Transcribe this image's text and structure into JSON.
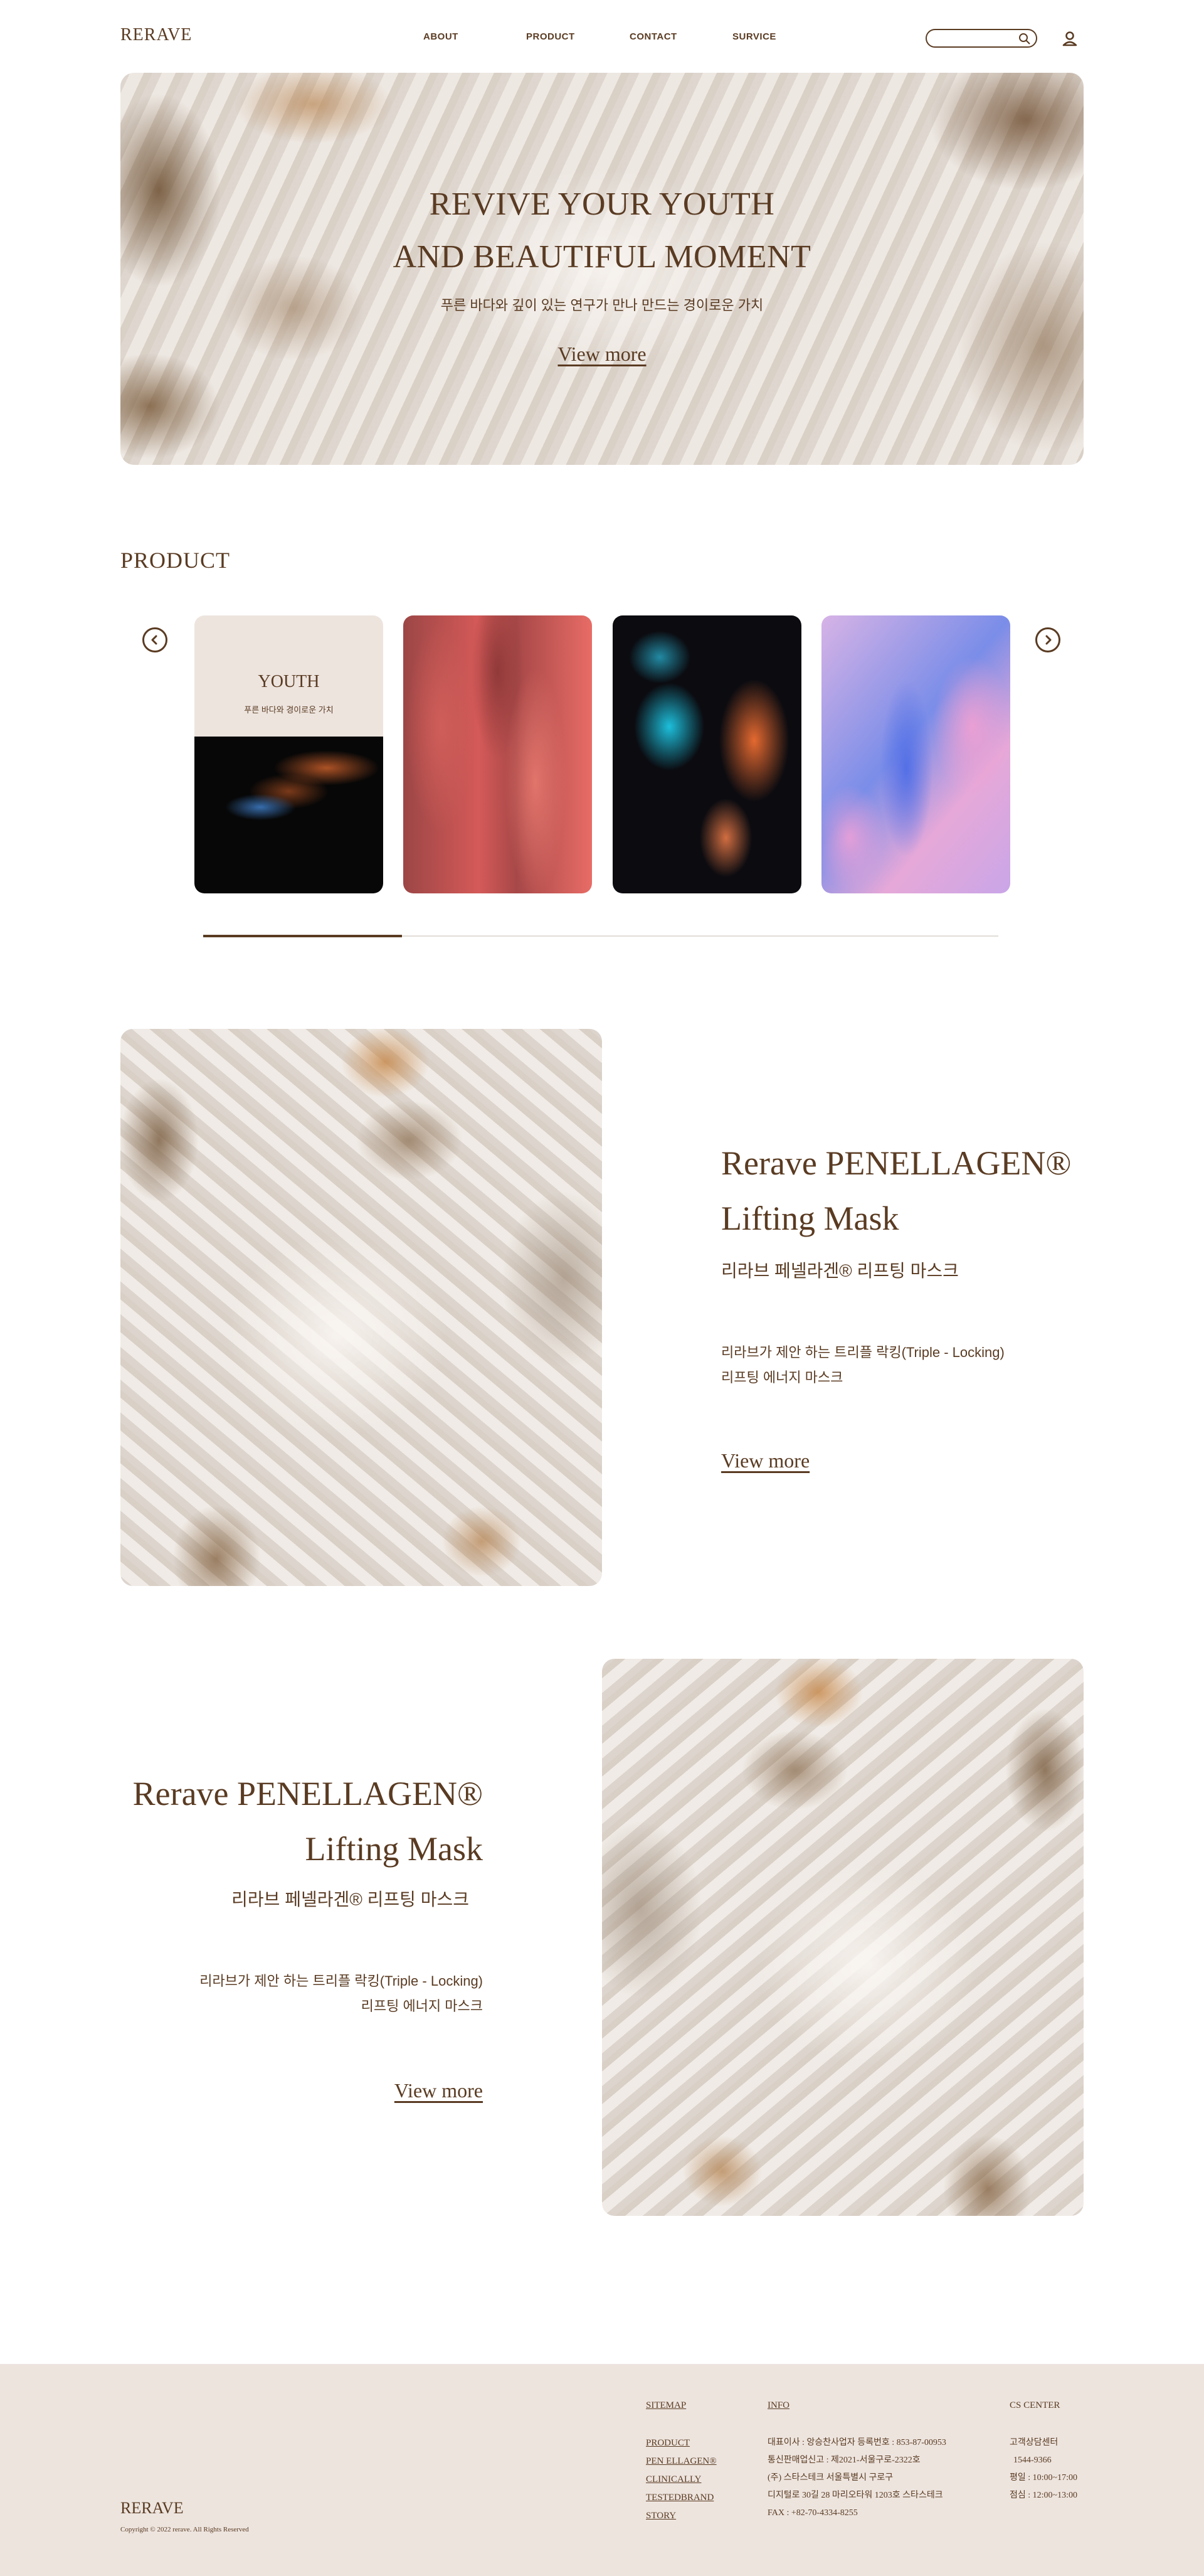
{
  "header": {
    "logo": "RERAVE",
    "nav": [
      "ABOUT",
      "PRODUCT",
      "CONTACT",
      "SURVICE"
    ],
    "search_placeholder": ""
  },
  "hero": {
    "title_line1": "REVIVE YOUR YOUTH",
    "title_line2": "AND BEAUTIFUL MOMENT",
    "subtitle": "푸른 바다와 깊이 있는 연구가 만나 만드는 경이로운 가치",
    "link": "View more"
  },
  "product": {
    "title": "PRODUCT",
    "cards": [
      {
        "title": "YOUTH",
        "subtitle": "푸른 바다와 경이로운 가치"
      },
      {
        "title": "",
        "subtitle": ""
      },
      {
        "title": "",
        "subtitle": ""
      },
      {
        "title": "",
        "subtitle": ""
      }
    ],
    "slider_progress": 0.25
  },
  "features": [
    {
      "title_line1": "Rerave PENELLAGEN®",
      "title_line2": "Lifting Mask",
      "subtitle": "리라브 페넬라겐® 리프팅 마스크",
      "desc_line1": "리라브가 제안 하는 트리플 락킹(Triple - Locking)",
      "desc_line2": "리프팅 에너지 마스크",
      "link": "View more"
    },
    {
      "title_line1": "Rerave PENELLAGEN®",
      "title_line2": "Lifting Mask",
      "subtitle": "리라브 페넬라겐® 리프팅 마스크",
      "desc_line1": "리라브가 제안 하는 트리플 락킹(Triple - Locking)",
      "desc_line2": "리프팅 에너지 마스크",
      "link": "View more"
    }
  ],
  "footer": {
    "logo": "RERAVE",
    "copyright": "Copyright © 2022 rerave. All Rights Reserved",
    "sitemap_title": "SITEMAP",
    "sitemap_links": [
      "PRODUCT",
      "PEN ELLAGEN®",
      "CLINICALLY",
      "TESTEDBRAND",
      "STORY"
    ],
    "info_title": "INFO",
    "info_lines": [
      "대표이사 : 앙승찬사업자 등록번호 : 853-87-00953",
      "통신판매업신고 : 제2021-서울구로-2322호",
      "(주) 스타스테크 서울특별시 구로구",
      "디지털로 30길 28 마리오타워 1203호 스타스테크",
      "FAX : +82-70-4334-8255"
    ],
    "cs_title": "CS CENTER",
    "cs_lines": [
      "고객상담센터",
      "1544-9366",
      "평일 : 10:00~17:00",
      "점심 : 12:00~13:00"
    ]
  }
}
